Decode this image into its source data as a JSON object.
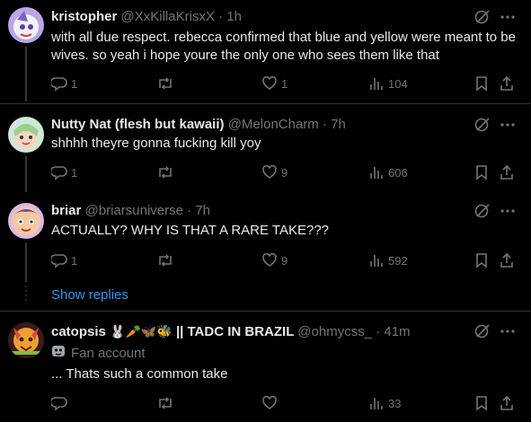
{
  "posts": [
    {
      "name": "kristopher",
      "handle": "@XxKillaKrisxX",
      "time": "1h",
      "text": "with all due respect. rebecca confirmed that blue and yellow were meant to be wives. so yeah i hope youre the only one who sees them like that",
      "replies": "1",
      "reposts": "",
      "likes": "1",
      "views": "104"
    },
    {
      "name": "Nutty Nat (flesh but kawaii)",
      "handle": "@MelonCharm",
      "time": "7h",
      "text": "shhhh theyre gonna fucking kill yoy",
      "replies": "1",
      "reposts": "",
      "likes": "9",
      "views": "606"
    },
    {
      "name": "briar",
      "handle": "@briarsuniverse",
      "time": "7h",
      "text": "ACTUALLY? WHY IS THAT A RARE TAKE???",
      "replies": "1",
      "reposts": "",
      "likes": "9",
      "views": "592"
    },
    {
      "name_prefix": "catopsis",
      "name_emojis": "🐰🥕🦋🐝",
      "name_suffix": "|| TADC IN BRAZIL",
      "handle": "@ohmycss_",
      "time": "41m",
      "badge": "Fan account",
      "text": "... Thats such a common take",
      "replies": "",
      "reposts": "",
      "likes": "",
      "views": "33"
    }
  ],
  "show_replies": "Show replies",
  "separator": "·",
  "colors": {
    "background": "#000000",
    "text": "#e7e9ea",
    "muted": "#71767b",
    "accent": "#1d9bf0",
    "divider": "#2f3336"
  },
  "icons": [
    "reply-icon",
    "repost-icon",
    "like-icon",
    "views-icon",
    "bookmark-icon",
    "share-icon",
    "grok-icon",
    "more-icon"
  ]
}
